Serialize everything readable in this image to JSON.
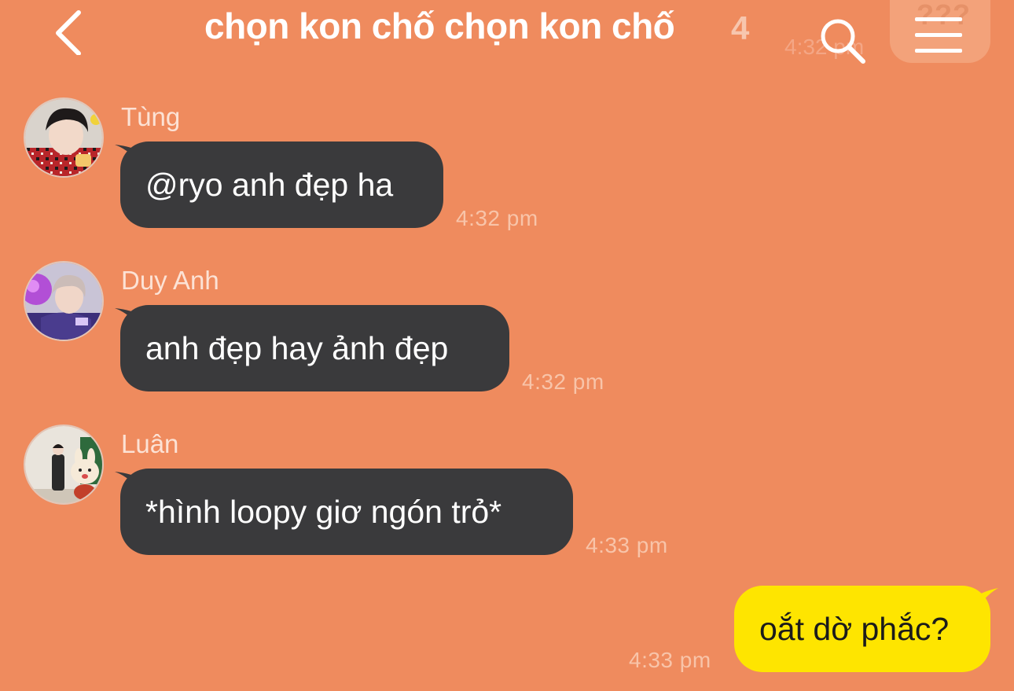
{
  "header": {
    "title": "chọn kon chố chọn kon chố",
    "member_count": "4",
    "ghost_time": "4:32 pm",
    "menu_ghost": "???"
  },
  "messages": [
    {
      "sender": "Tùng",
      "text": "@ryo anh đẹp ha",
      "time": "4:32 pm"
    },
    {
      "sender": "Duy Anh",
      "text": "anh đẹp hay ảnh đẹp",
      "time": "4:32 pm"
    },
    {
      "sender": "Luân",
      "text": "*hình loopy giơ ngón trỏ*",
      "time": "4:33 pm"
    }
  ],
  "my_message": {
    "text": "oắt dờ phắc?",
    "time": "4:33 pm"
  },
  "colors": {
    "background": "#EF8B5E",
    "incoming_bubble": "#3A3A3C",
    "outgoing_bubble": "#FEE500"
  },
  "icons": [
    "back-icon",
    "search-icon",
    "menu-icon"
  ]
}
